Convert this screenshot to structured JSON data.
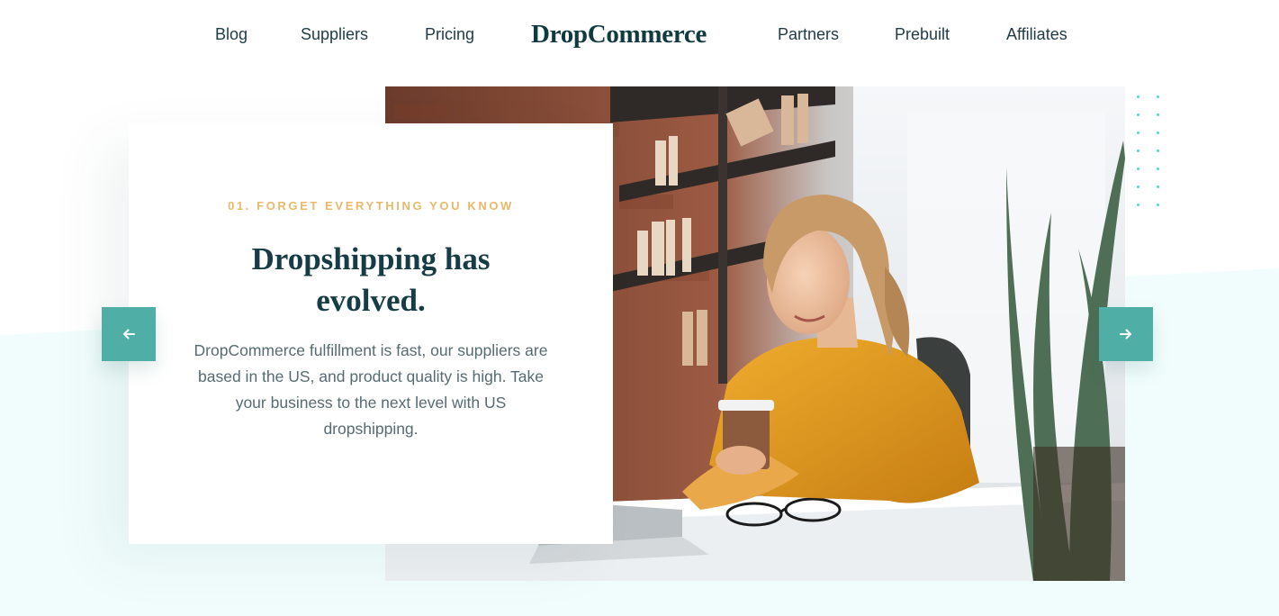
{
  "nav": {
    "links_left": [
      {
        "label": "Blog"
      },
      {
        "label": "Suppliers"
      },
      {
        "label": "Pricing"
      }
    ],
    "logo": "DropCommerce",
    "links_right": [
      {
        "label": "Partners"
      },
      {
        "label": "Prebuilt"
      },
      {
        "label": "Affiliates"
      }
    ]
  },
  "hero": {
    "eyebrow": "01. FORGET EVERYTHING YOU KNOW",
    "headline_line1": "Dropshipping has",
    "headline_line2": "evolved.",
    "body": "DropCommerce fulfillment is fast, our suppliers are based in the US, and product quality is high. Take your business to the next level with US dropshipping.",
    "prev_icon": "arrow-left-icon",
    "next_icon": "arrow-right-icon"
  },
  "colors": {
    "accent": "#4fafa6",
    "eyebrow": "#eab86a",
    "heading": "#163c45",
    "band": "#f1fdfc",
    "dots": "#4fd6d8"
  }
}
